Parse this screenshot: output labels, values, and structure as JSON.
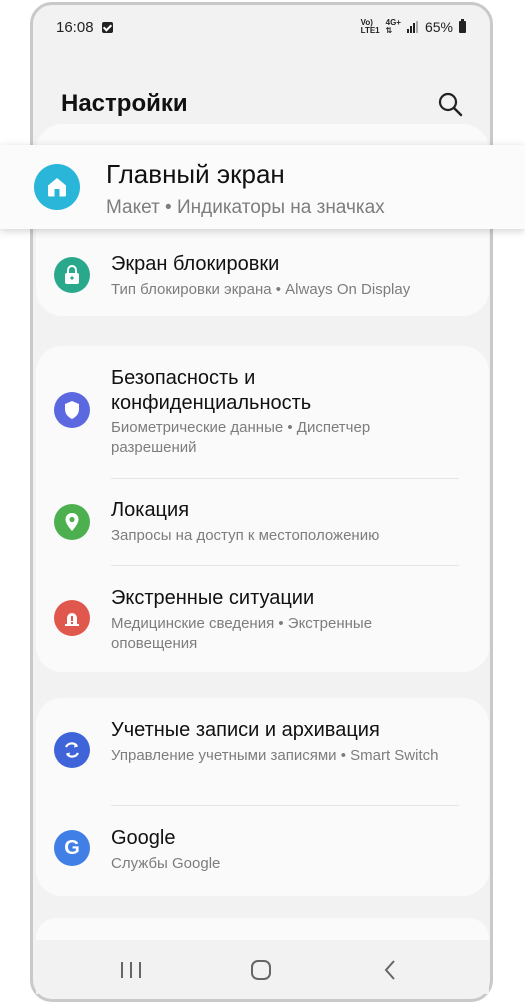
{
  "status_bar": {
    "time": "16:08",
    "network_line1": "Vo)",
    "network_line2": "LTE1",
    "network_type": "4G+",
    "battery": "65%"
  },
  "header": {
    "title": "Настройки"
  },
  "highlight": {
    "title": "Главный экран",
    "subtitle": "Макет  •  Индикаторы на значках"
  },
  "items": [
    {
      "title": "Экран блокировки",
      "subtitle": "Тип блокировки экрана  •  Always On Display"
    },
    {
      "title": "Безопасность и\nконфиденциальность",
      "subtitle": "Биометрические данные  •  Диспетчер разрешений"
    },
    {
      "title": "Локация",
      "subtitle": "Запросы на доступ к местоположению"
    },
    {
      "title": "Экстренные ситуации",
      "subtitle": "Медицинские сведения  •  Экстренные оповещения"
    },
    {
      "title": "Учетные записи и архивация",
      "subtitle": "Управление учетными записями  •  Smart Switch"
    },
    {
      "title": "Google",
      "subtitle": "Службы Google"
    }
  ],
  "colors": {
    "home": "#29b6d8",
    "lock": "#2aa88c",
    "security": "#5b68e0",
    "location": "#4cb04f",
    "emergency": "#e0584d",
    "accounts": "#3f63d9",
    "google": "#3f7fe6"
  },
  "icons": {
    "home": "home-icon",
    "lock": "lock-icon",
    "security": "shield-icon",
    "location": "location-pin-icon",
    "emergency": "alert-icon",
    "accounts": "sync-icon",
    "google": "google-icon"
  }
}
